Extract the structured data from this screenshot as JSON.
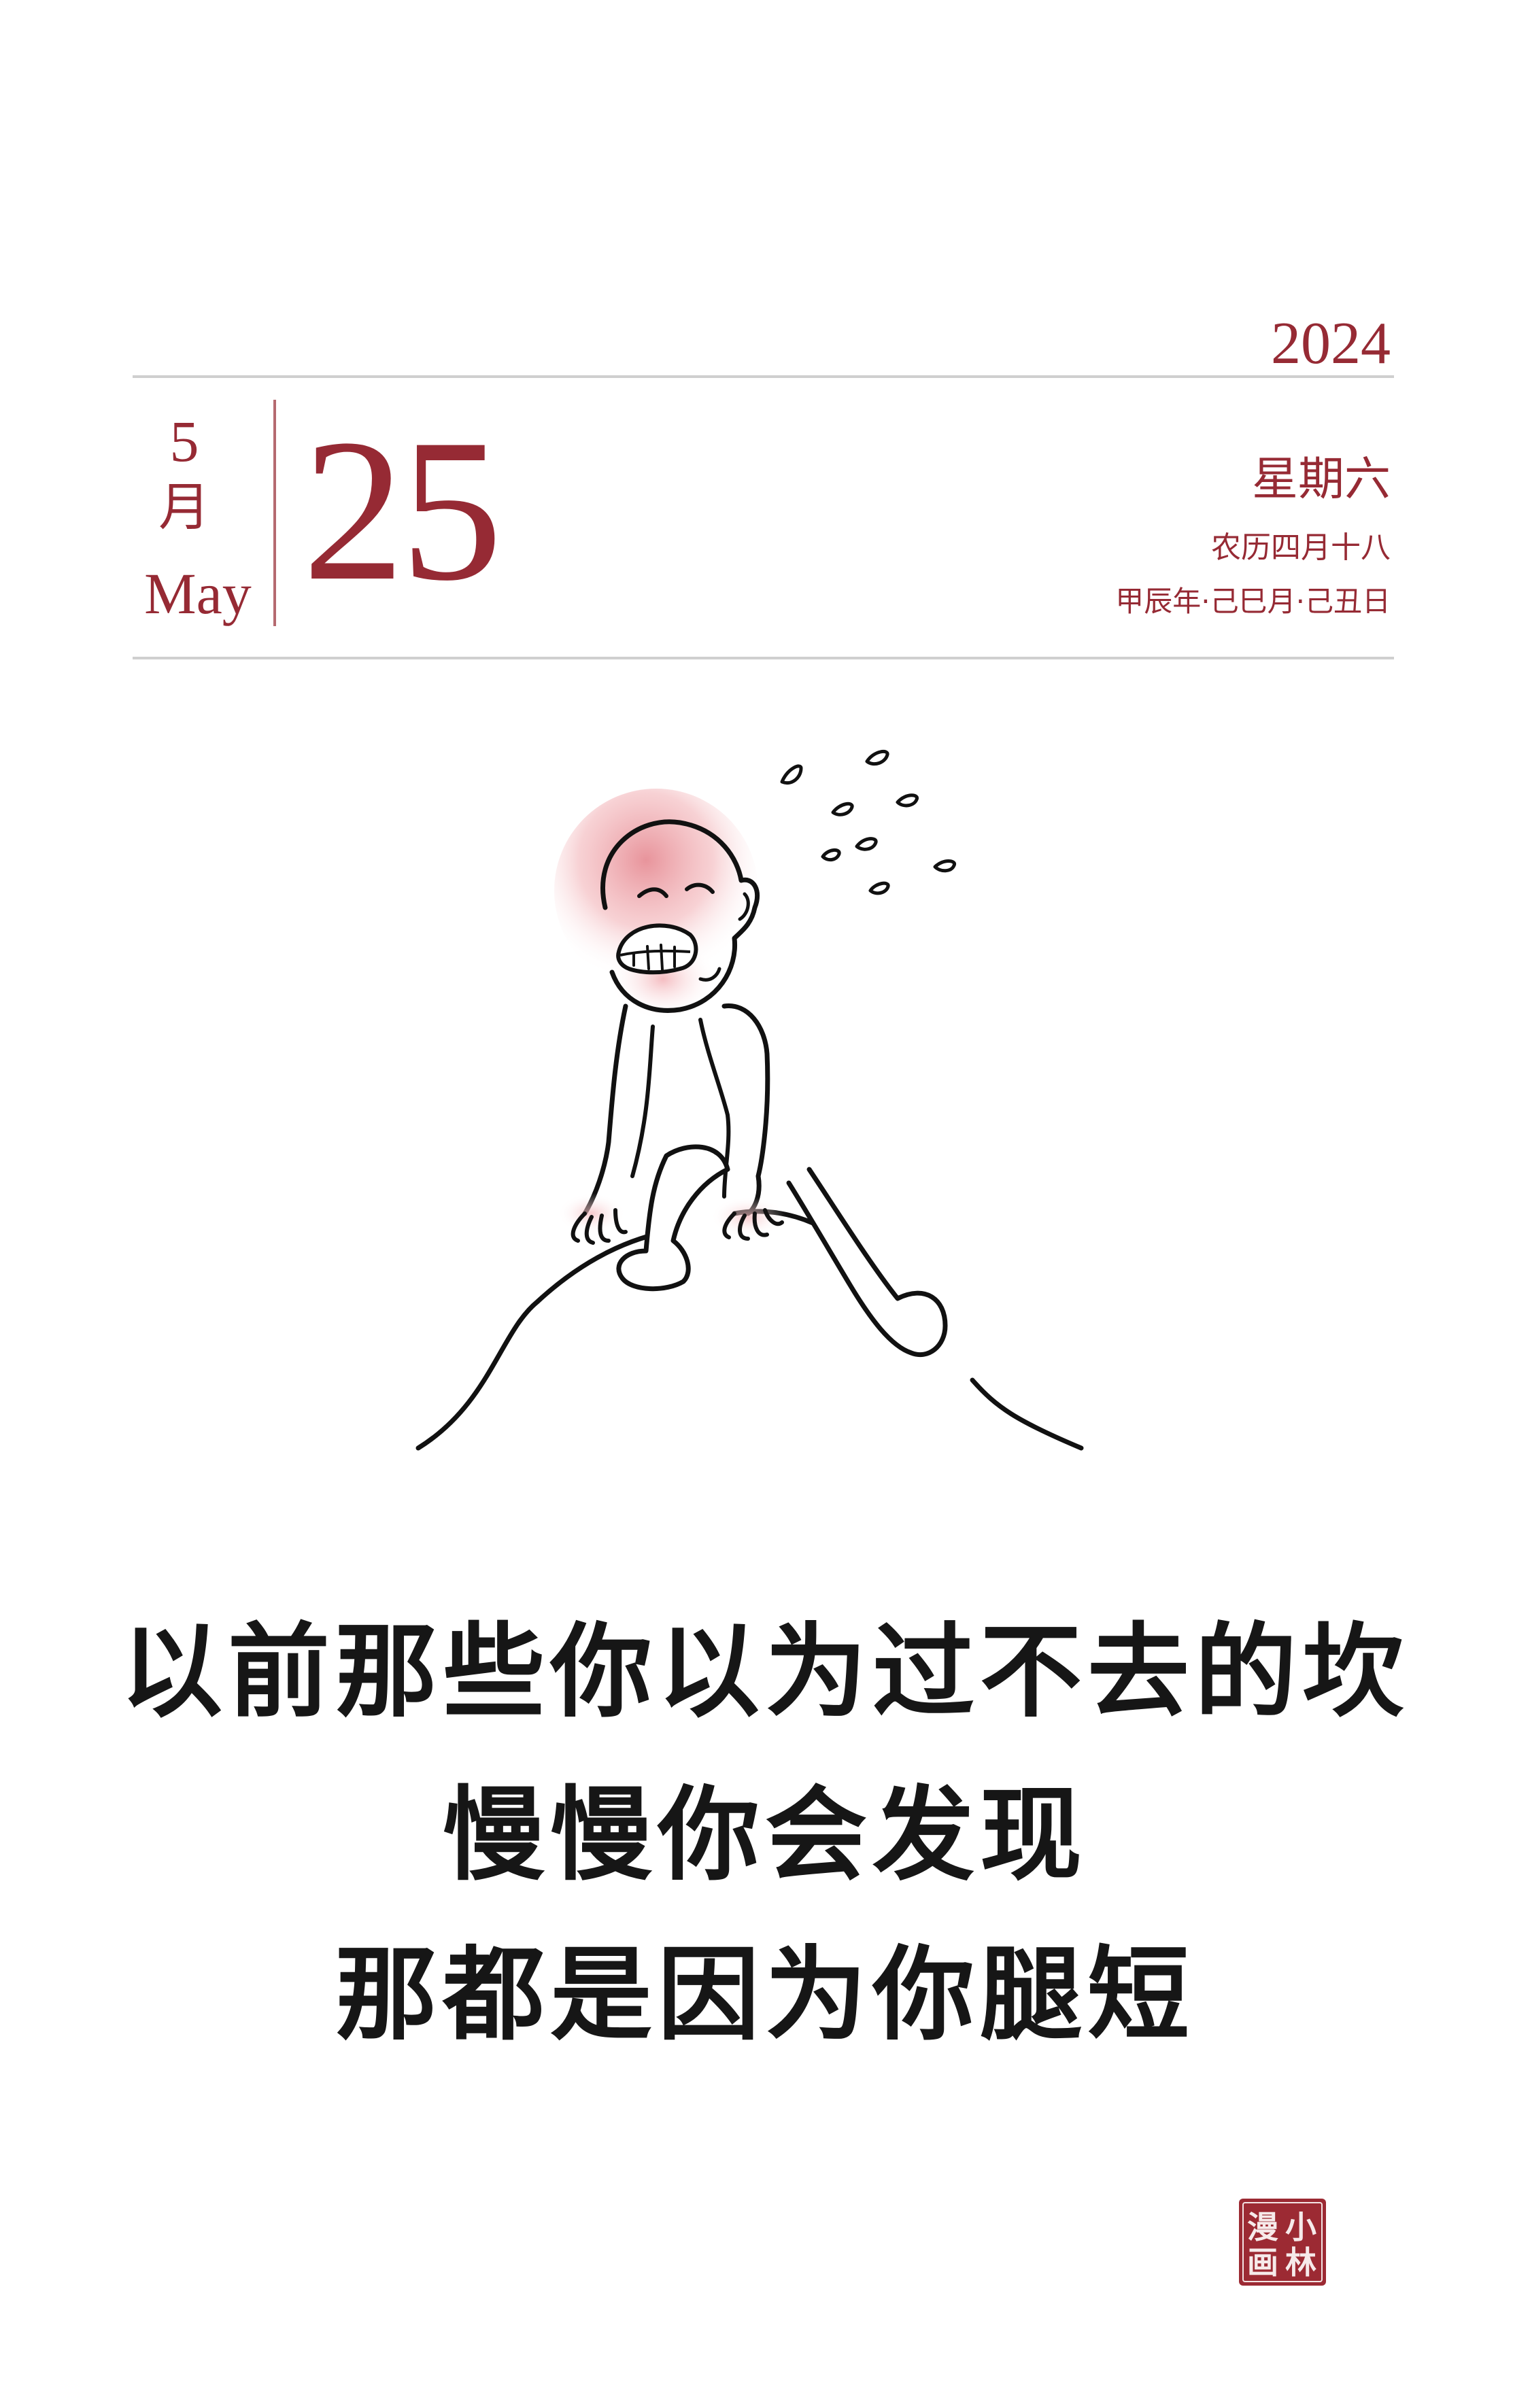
{
  "calendar": {
    "year": "2024",
    "month_number": "5",
    "month_cn": "月",
    "month_en": "May",
    "day": "25",
    "weekday": "星期六",
    "lunar_date": "农历四月十八",
    "ganzhi": "甲辰年·己巳月·己丑日"
  },
  "caption": {
    "line1": "以前那些你以为过不去的坎",
    "line2": "慢慢你会发现",
    "line3": "那都是因为你腿短"
  },
  "seal": {
    "text": "小林漫画"
  },
  "colors": {
    "accent": "#962a34",
    "rule": "#cfcfcf",
    "ink": "#161616"
  }
}
